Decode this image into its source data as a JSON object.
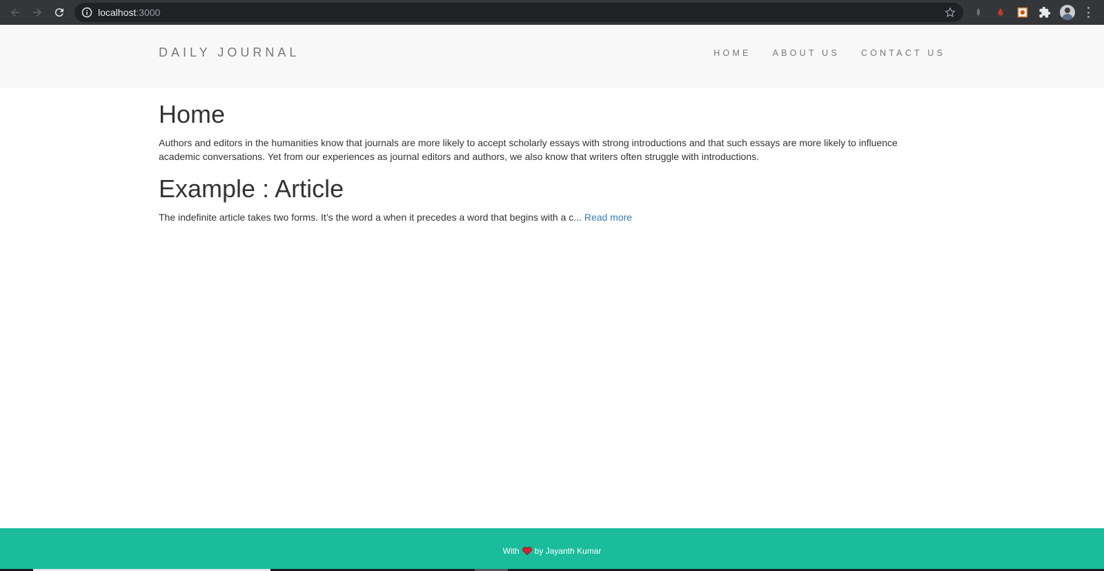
{
  "browser": {
    "url_host": "localhost",
    "url_port": ":3000"
  },
  "header": {
    "brand": "DAILY JOURNAL",
    "nav": [
      {
        "label": "HOME"
      },
      {
        "label": "ABOUT US"
      },
      {
        "label": "CONTACT US"
      }
    ]
  },
  "main": {
    "home_title": "Home",
    "home_text": "Authors and editors in the humanities know that journals are more likely to accept scholarly essays with strong introductions and that such essays are more likely to influence academic conversations. Yet from our experiences as journal editors and authors, we also know that writers often struggle with introductions.",
    "post": {
      "title": "Example : Article",
      "excerpt": "The indefinite article takes two forms. It’s the word a when it precedes a word that begins with a c...",
      "read_more": "Read more"
    }
  },
  "footer": {
    "prefix": "With",
    "suffix": "by Jayanth Kumar",
    "heart_icon": "heart-icon"
  },
  "colors": {
    "footer_bg": "#1abc9c",
    "header_bg": "#f8f8f8",
    "link": "#337ab7"
  }
}
